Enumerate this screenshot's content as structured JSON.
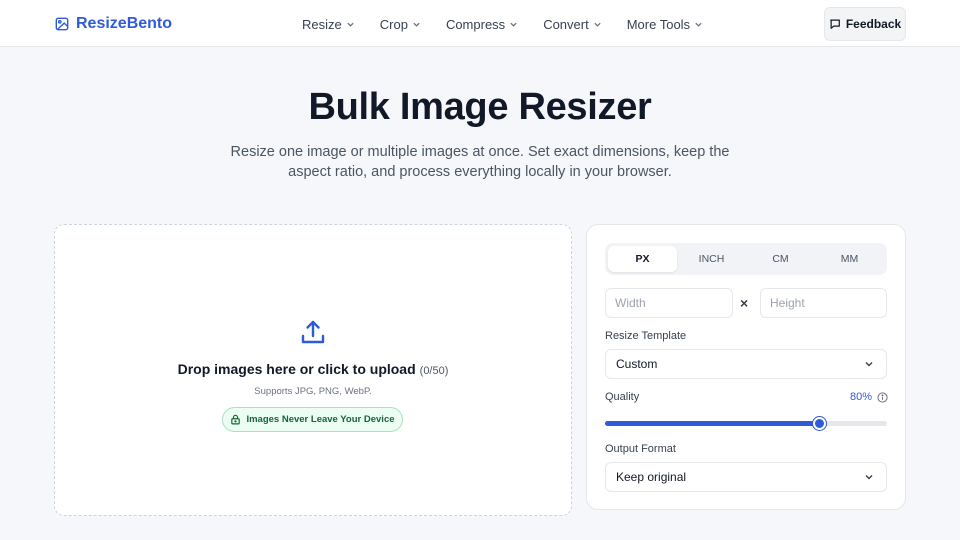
{
  "header": {
    "brand": "ResizeBento",
    "nav": [
      {
        "label": "Resize"
      },
      {
        "label": "Crop"
      },
      {
        "label": "Compress"
      },
      {
        "label": "Convert"
      },
      {
        "label": "More Tools"
      }
    ],
    "feedback_label": "Feedback"
  },
  "hero": {
    "title": "Bulk Image Resizer",
    "subtitle": "Resize one image or multiple images at once. Set exact dimensions, keep the aspect ratio, and process everything locally in your browser."
  },
  "dropzone": {
    "text": "Drop images here or click to upload",
    "count": "(0/50)",
    "supports": "Supports JPG, PNG, WebP.",
    "privacy_badge": "Images Never Leave Your Device"
  },
  "settings": {
    "units": [
      {
        "label": "PX",
        "active": true
      },
      {
        "label": "INCH",
        "active": false
      },
      {
        "label": "CM",
        "active": false
      },
      {
        "label": "MM",
        "active": false
      }
    ],
    "width_placeholder": "Width",
    "height_placeholder": "Height",
    "times_symbol": "×",
    "template_label": "Resize Template",
    "template_value": "Custom",
    "quality_label": "Quality",
    "quality_value_text": "80%",
    "quality_fraction": 0.76,
    "output_label": "Output Format",
    "output_value": "Keep original"
  },
  "colors": {
    "accent": "#2f5bd8",
    "privacy_green": "#166534"
  }
}
